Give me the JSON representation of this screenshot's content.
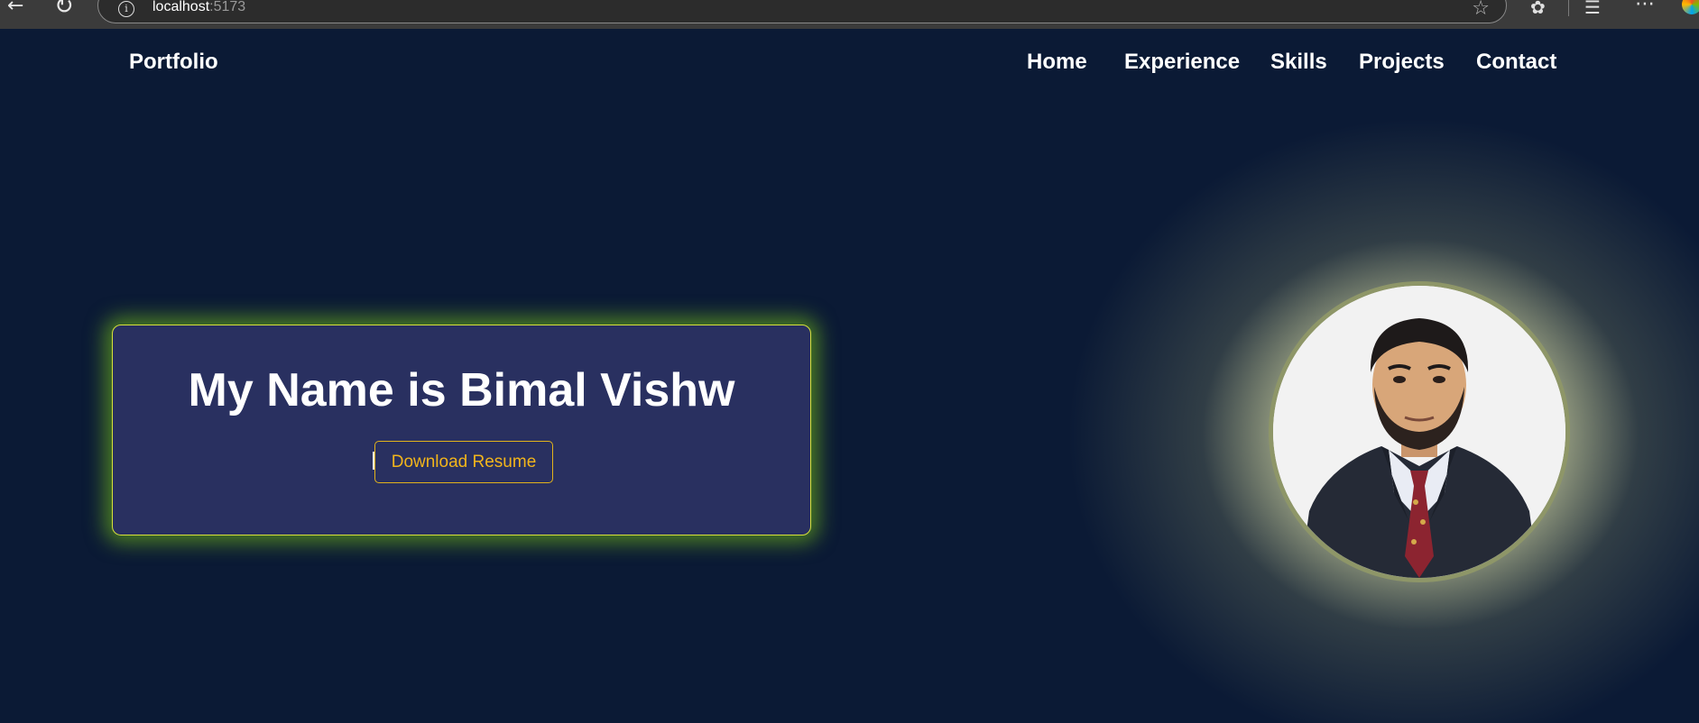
{
  "browser": {
    "url_host": "localhost",
    "url_port": ":5173",
    "icons": [
      "back-arrow-icon",
      "reload-icon",
      "info-icon",
      "star-icon",
      "extensions-icon",
      "favorites-icon",
      "more-icon",
      "copilot-icon"
    ]
  },
  "navbar": {
    "brand": "Portfolio",
    "items": [
      {
        "label": "Home"
      },
      {
        "label": "Experience"
      },
      {
        "label": "Skills"
      },
      {
        "label": "Projects"
      },
      {
        "label": "Contact"
      }
    ]
  },
  "hero": {
    "title": "My Name is Bimal Vishw",
    "resume_button": "Download Resume"
  },
  "colors": {
    "background": "#0b1a35",
    "card": "#293060",
    "card_border": "#d8e23a",
    "card_glow": "#82d214",
    "button_accent": "#f2b51b",
    "avatar_glow": "#d2d7af"
  }
}
